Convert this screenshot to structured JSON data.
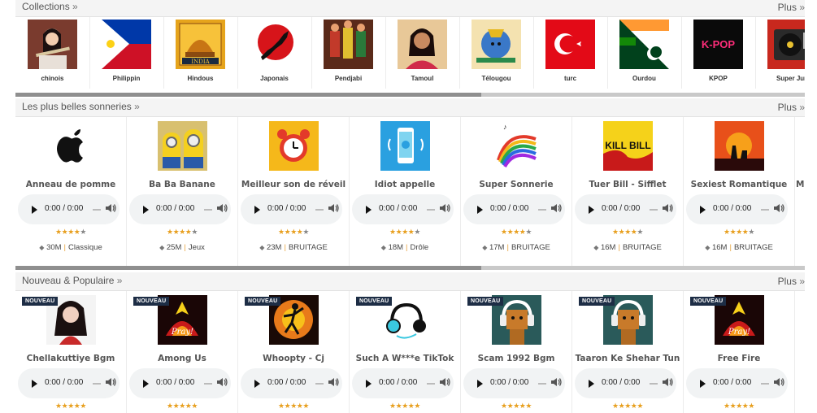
{
  "collections": {
    "title": "Collections",
    "more": "Plus",
    "arrow": "»",
    "items": [
      {
        "label": "chinois",
        "icon": "woman-flute-photo"
      },
      {
        "label": "Philippin",
        "icon": "philippines-flag"
      },
      {
        "label": "Hindous",
        "icon": "india-poster"
      },
      {
        "label": "Japonais",
        "icon": "japan-map-sun"
      },
      {
        "label": "Pendjabi",
        "icon": "punjabi-dancers"
      },
      {
        "label": "Tamoul",
        "icon": "tamil-woman-photo"
      },
      {
        "label": "Télougou",
        "icon": "krishna-painting"
      },
      {
        "label": "turc",
        "icon": "turkey-flag"
      },
      {
        "label": "Ourdou",
        "icon": "india-pakistan-flags"
      },
      {
        "label": "KPOP",
        "icon": "kpop-logo"
      },
      {
        "label": "Super Jun",
        "icon": "turntable"
      }
    ],
    "scroll_fraction": 0.59
  },
  "best": {
    "title": "Les plus belles sonneries",
    "more": "Plus",
    "arrow": "»",
    "scroll_fraction": 0.59,
    "items": [
      {
        "title": "Anneau de pomme",
        "icon": "apple-logo",
        "time": "0:00 / 0:00",
        "rating": 4,
        "meta_count": "30M",
        "meta_cat": "Classique"
      },
      {
        "title": "Ba Ba Banane",
        "icon": "minions",
        "time": "0:00 / 0:00",
        "rating": 4,
        "meta_count": "25M",
        "meta_cat": "Jeux"
      },
      {
        "title": "Meilleur son de réveil",
        "icon": "alarm-clock",
        "time": "0:00 / 0:00",
        "rating": 4,
        "meta_count": "23M",
        "meta_cat": "BRUITAGE"
      },
      {
        "title": "Idiot appelle",
        "icon": "phone-hello",
        "time": "0:00 / 0:00",
        "rating": 4,
        "meta_count": "18M",
        "meta_cat": "Drôle"
      },
      {
        "title": "Super Sonnerie",
        "icon": "rainbow-piano",
        "time": "0:00 / 0:00",
        "rating": 4,
        "meta_count": "17M",
        "meta_cat": "BRUITAGE"
      },
      {
        "title": "Tuer Bill - Sifflet",
        "icon": "kill-bill-poster",
        "time": "0:00 / 0:00",
        "rating": 4,
        "meta_count": "16M",
        "meta_cat": "BRUITAGE"
      },
      {
        "title": "Sexiest Romantique",
        "icon": "romantic-sunset",
        "time": "0:00 / 0:00",
        "rating": 4,
        "meta_count": "16M",
        "meta_cat": "BRUITAGE"
      }
    ],
    "partial_title": "Ma"
  },
  "new": {
    "title": "Nouveau & Populaire",
    "more": "Plus",
    "arrow": "»",
    "badge": "NOUVEAU",
    "items": [
      {
        "title": "Chellakuttiye Bgm",
        "icon": "girl-portrait",
        "time": "0:00 / 0:00",
        "rating": 5
      },
      {
        "title": "Among Us",
        "icon": "pray-fire-art",
        "time": "0:00 / 0:00",
        "rating": 5
      },
      {
        "title": "Whoopty - Cj",
        "icon": "dancer-silhouette",
        "time": "0:00 / 0:00",
        "rating": 5
      },
      {
        "title": "Such A W***e TikTok",
        "icon": "headphones-art",
        "time": "0:00 / 0:00",
        "rating": 5
      },
      {
        "title": "Scam 1992 Bgm",
        "icon": "robot-headphones",
        "time": "0:00 / 0:00",
        "rating": 5
      },
      {
        "title": "Taaron Ke Shehar Tun",
        "icon": "robot-headphones",
        "time": "0:00 / 0:00",
        "rating": 5
      },
      {
        "title": "Free Fire",
        "icon": "pray-fire-art",
        "time": "0:00 / 0:00",
        "rating": 5
      }
    ]
  },
  "star_char": "★",
  "diamond_char": "◆",
  "separator": "|"
}
